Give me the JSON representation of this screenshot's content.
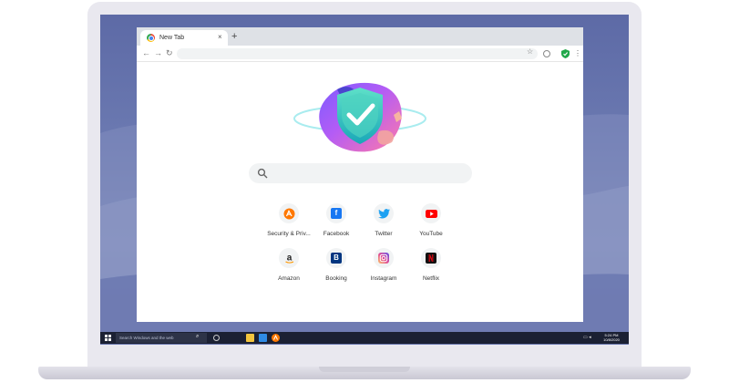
{
  "browser": {
    "tab_title": "New Tab",
    "tab_close_label": "×",
    "new_tab_label": "+",
    "back_label": "←",
    "forward_label": "→",
    "reload_label": "↻",
    "star_label": "☆",
    "menu_label": "⋮",
    "address_value": "",
    "search_placeholder": ""
  },
  "shortcuts": [
    {
      "label": "Security & Priv...",
      "icon": "avast-icon",
      "color": "#ff7800"
    },
    {
      "label": "Facebook",
      "icon": "facebook-icon",
      "color": "#1877f2"
    },
    {
      "label": "Twitter",
      "icon": "twitter-icon",
      "color": "#1da1f2"
    },
    {
      "label": "YouTube",
      "icon": "youtube-icon",
      "color": "#ff0000"
    },
    {
      "label": "Amazon",
      "icon": "amazon-icon",
      "color": "#222222"
    },
    {
      "label": "Booking",
      "icon": "booking-icon",
      "color": "#003580"
    },
    {
      "label": "Instagram",
      "icon": "instagram-icon",
      "color": "#d6249f"
    },
    {
      "label": "Netflix",
      "icon": "netflix-icon",
      "color": "#e50914"
    }
  ],
  "taskbar": {
    "search_placeholder": "Search Windows and the web",
    "time": "5:24 PM",
    "date": "10/8/2020"
  },
  "colors": {
    "wallpaper": "#6a78b0",
    "shield_accent": "#2ec4b6",
    "taskbar": "#1b2033"
  }
}
